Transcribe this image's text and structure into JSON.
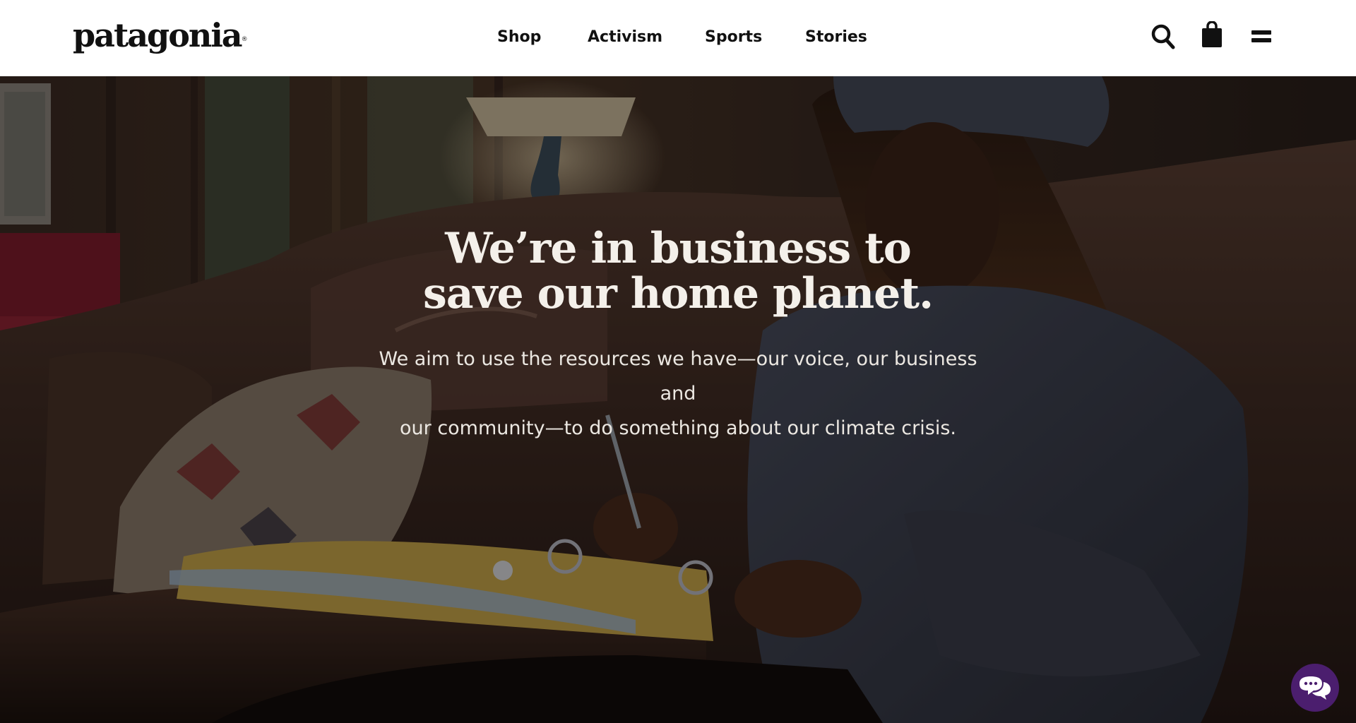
{
  "brand": {
    "logo_text": "patagonia",
    "registered_mark": "®"
  },
  "nav": {
    "items": [
      {
        "label": "Shop"
      },
      {
        "label": "Activism"
      },
      {
        "label": "Sports"
      },
      {
        "label": "Stories"
      }
    ]
  },
  "header_icons": {
    "search": "search-icon",
    "bag": "shopping-bag-icon",
    "menu": "menu-icon"
  },
  "hero": {
    "headline_line1": "We’re in business to",
    "headline_line2": "save our home planet.",
    "subtext_line1": "We aim to use the resources we have—our voice, our business and",
    "subtext_line2": "our community—to do something about our climate crisis.",
    "image": "woman-writing-in-notebook-on-leather-sofa"
  },
  "chat": {
    "icon": "chat-bubbles-icon",
    "color": "#4b1e6e"
  },
  "colors": {
    "header_bg": "#ffffff",
    "text_dark": "#111111",
    "hero_text": "#f4f0ea"
  }
}
